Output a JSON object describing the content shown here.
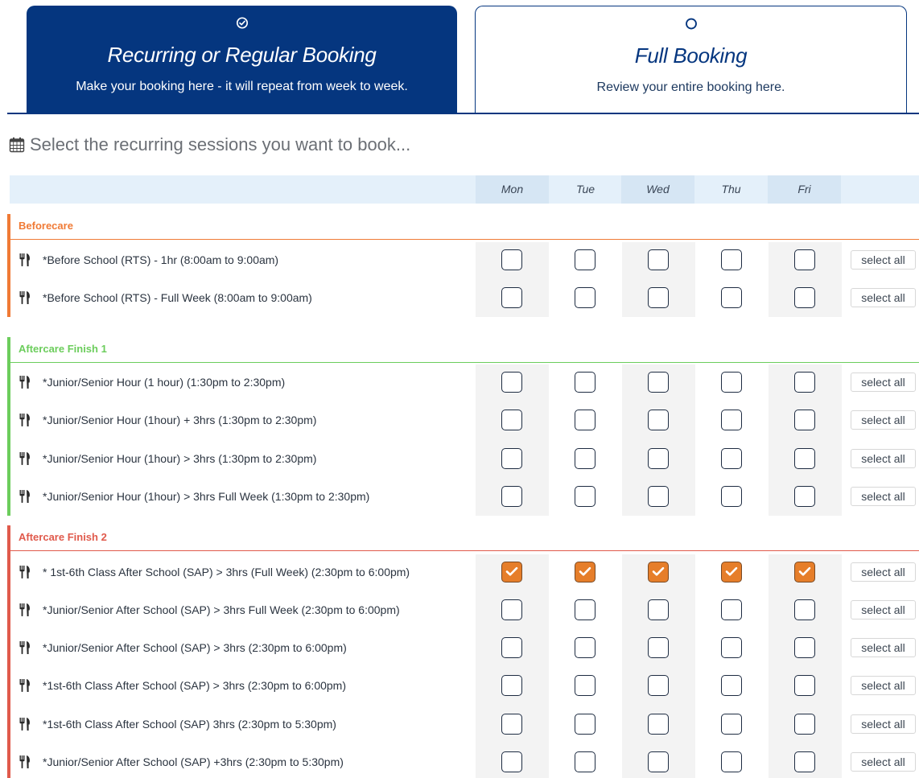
{
  "steps": [
    {
      "title": "Recurring or Regular Booking",
      "description": "Make your booking here - it will repeat from week to week.",
      "icon": "check-circle-icon",
      "active": true
    },
    {
      "title": "Full Booking",
      "description": "Review your entire booking here.",
      "icon": "circle-icon",
      "active": false
    }
  ],
  "heading": {
    "icon": "calendar-icon",
    "text": "Select the recurring sessions you want to book..."
  },
  "days": [
    "Mon",
    "Tue",
    "Wed",
    "Thu",
    "Fri"
  ],
  "select_all_label": "select all",
  "colors": {
    "primary": "#05367f",
    "beforecare": "#f07a35",
    "aftercare1": "#6ccd5c",
    "aftercare2": "#e05a4c",
    "checked": "#e67e2a"
  },
  "groups": [
    {
      "name": "Beforecare",
      "color": "#f07a35",
      "rows": [
        {
          "label": "*Before School (RTS) - 1hr (8:00am to 9:00am)",
          "checked": [
            false,
            false,
            false,
            false,
            false
          ]
        },
        {
          "label": "*Before School (RTS) - Full Week (8:00am to 9:00am)",
          "checked": [
            false,
            false,
            false,
            false,
            false
          ]
        }
      ]
    },
    {
      "name": "Aftercare Finish 1",
      "color": "#6ccd5c",
      "rows": [
        {
          "label": "*Junior/Senior Hour (1 hour) (1:30pm to 2:30pm)",
          "checked": [
            false,
            false,
            false,
            false,
            false
          ]
        },
        {
          "label": "*Junior/Senior Hour (1hour) + 3hrs (1:30pm to 2:30pm)",
          "checked": [
            false,
            false,
            false,
            false,
            false
          ]
        },
        {
          "label": "*Junior/Senior Hour (1hour) > 3hrs (1:30pm to 2:30pm)",
          "checked": [
            false,
            false,
            false,
            false,
            false
          ]
        },
        {
          "label": "*Junior/Senior Hour (1hour) > 3hrs Full Week (1:30pm to 2:30pm)",
          "checked": [
            false,
            false,
            false,
            false,
            false
          ]
        }
      ]
    },
    {
      "name": "Aftercare Finish 2",
      "color": "#e05a4c",
      "rows": [
        {
          "label": "* 1st-6th Class After School (SAP) > 3hrs (Full Week) (2:30pm to 6:00pm)",
          "checked": [
            true,
            true,
            true,
            true,
            true
          ]
        },
        {
          "label": "*Junior/Senior After School (SAP) > 3hrs Full Week (2:30pm to 6:00pm)",
          "checked": [
            false,
            false,
            false,
            false,
            false
          ]
        },
        {
          "label": "*Junior/Senior After School (SAP) > 3hrs (2:30pm to 6:00pm)",
          "checked": [
            false,
            false,
            false,
            false,
            false
          ]
        },
        {
          "label": "*1st-6th Class After School (SAP) > 3hrs (2:30pm to 6:00pm)",
          "checked": [
            false,
            false,
            false,
            false,
            false
          ]
        },
        {
          "label": "*1st-6th Class After School (SAP) 3hrs (2:30pm to 5:30pm)",
          "checked": [
            false,
            false,
            false,
            false,
            false
          ]
        },
        {
          "label": "*Junior/Senior After School (SAP) +3hrs (2:30pm to 5:30pm)",
          "checked": [
            false,
            false,
            false,
            false,
            false
          ]
        }
      ]
    }
  ]
}
